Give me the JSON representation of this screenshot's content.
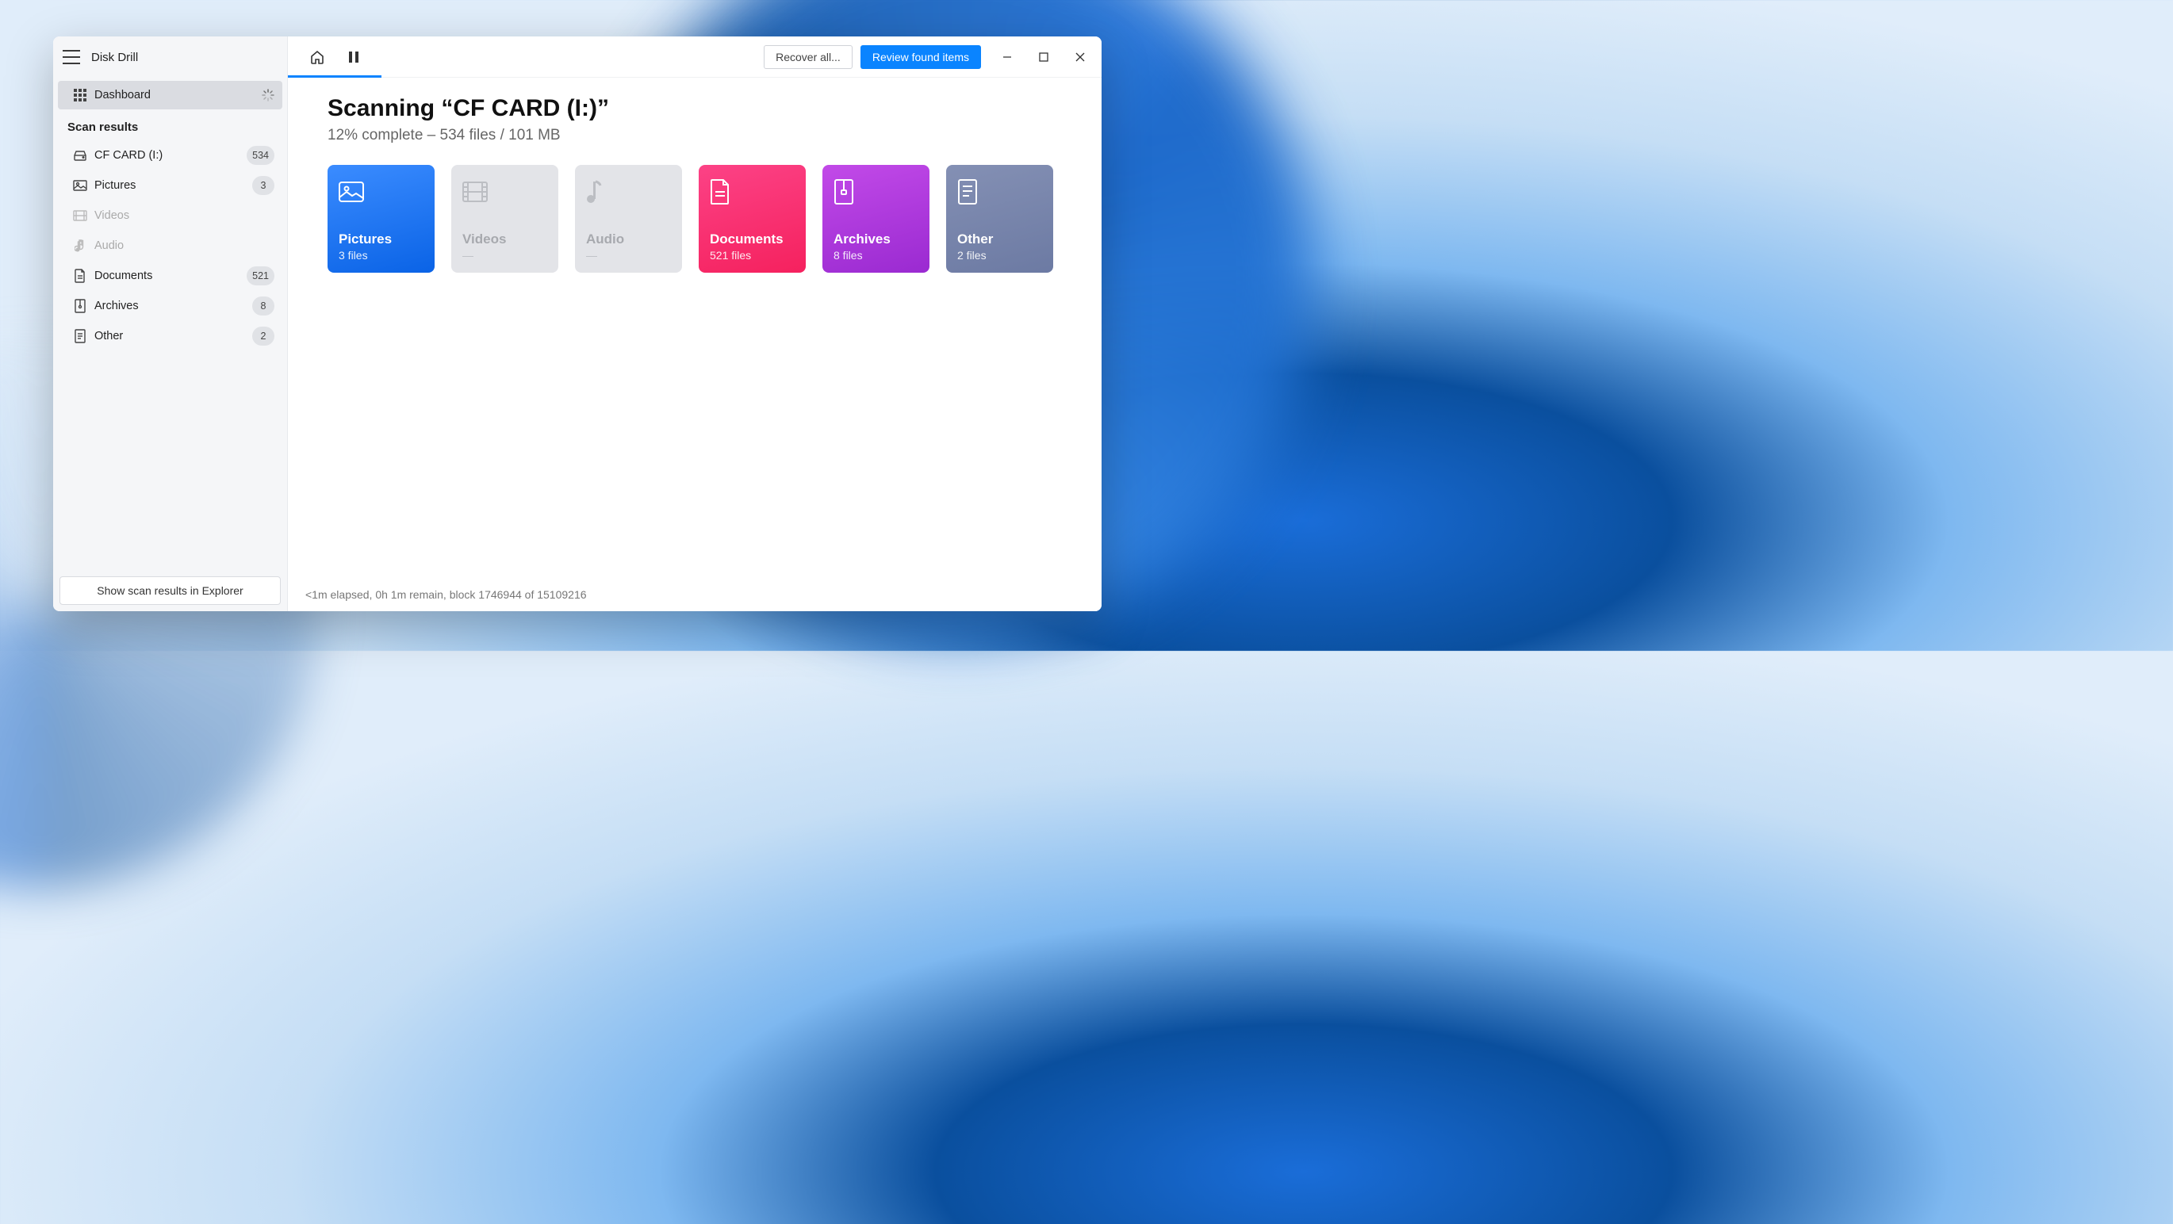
{
  "app": {
    "title": "Disk Drill"
  },
  "sidebar": {
    "dashboard": "Dashboard",
    "section_title": "Scan results",
    "items": [
      {
        "icon": "drive",
        "label": "CF CARD (I:)",
        "count": "534",
        "dim": false
      },
      {
        "icon": "picture",
        "label": "Pictures",
        "count": "3",
        "dim": false
      },
      {
        "icon": "video",
        "label": "Videos",
        "count": "",
        "dim": true
      },
      {
        "icon": "audio",
        "label": "Audio",
        "count": "",
        "dim": true
      },
      {
        "icon": "document",
        "label": "Documents",
        "count": "521",
        "dim": false
      },
      {
        "icon": "archive",
        "label": "Archives",
        "count": "8",
        "dim": false
      },
      {
        "icon": "other",
        "label": "Other",
        "count": "2",
        "dim": false
      }
    ],
    "footer_btn": "Show scan results in Explorer"
  },
  "toolbar": {
    "recover_all": "Recover all...",
    "review": "Review found items"
  },
  "main": {
    "title": "Scanning “CF CARD (I:)”",
    "subtitle": "12% complete – 534 files / 101 MB"
  },
  "cards": [
    {
      "key": "pictures",
      "title": "Pictures",
      "sub": "3 files"
    },
    {
      "key": "videos",
      "title": "Videos",
      "sub": "—"
    },
    {
      "key": "audio",
      "title": "Audio",
      "sub": "—"
    },
    {
      "key": "documents",
      "title": "Documents",
      "sub": "521 files"
    },
    {
      "key": "archives",
      "title": "Archives",
      "sub": "8 files"
    },
    {
      "key": "other",
      "title": "Other",
      "sub": "2 files"
    }
  ],
  "status": "<1m elapsed, 0h 1m remain, block 1746944 of 15109216"
}
